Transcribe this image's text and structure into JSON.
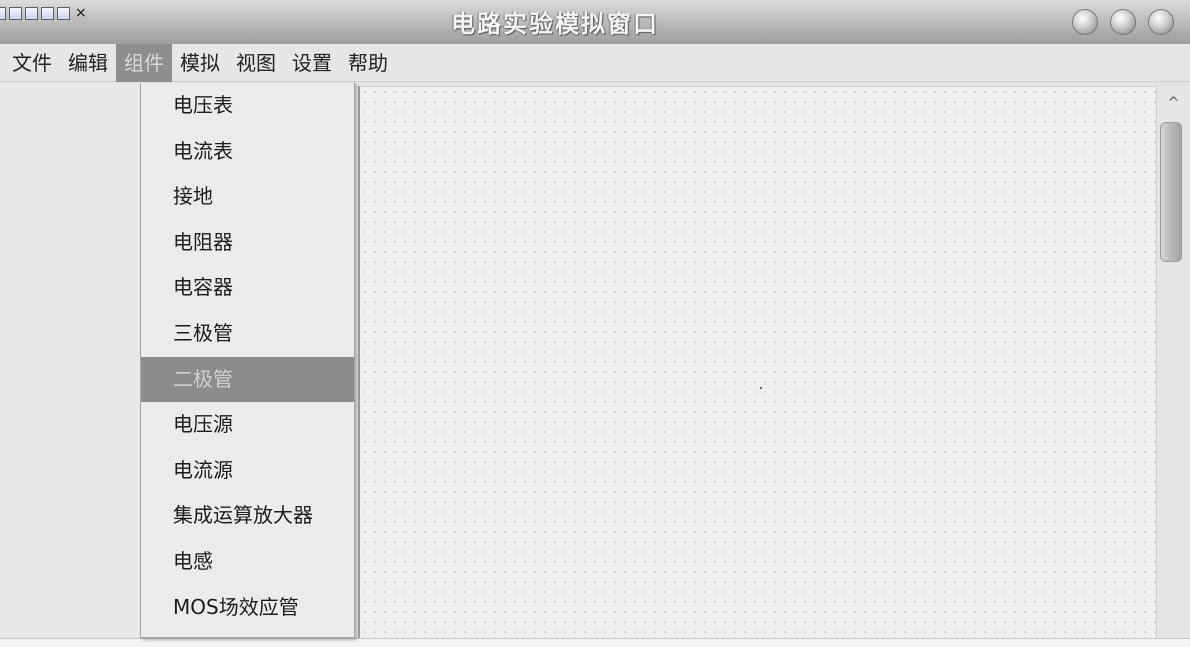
{
  "window": {
    "title": "电路实验模拟窗口"
  },
  "menubar": {
    "items": [
      {
        "label": "文件"
      },
      {
        "label": "编辑"
      },
      {
        "label": "组件"
      },
      {
        "label": "模拟"
      },
      {
        "label": "视图"
      },
      {
        "label": "设置"
      },
      {
        "label": "帮助"
      }
    ],
    "active": "组件"
  },
  "dropdown": {
    "items": [
      {
        "label": "电压表"
      },
      {
        "label": "电流表"
      },
      {
        "label": "接地"
      },
      {
        "label": "电阻器"
      },
      {
        "label": "电容器"
      },
      {
        "label": "三极管"
      },
      {
        "label": "二极管"
      },
      {
        "label": "电压源"
      },
      {
        "label": "电流源"
      },
      {
        "label": "集成运算放大器"
      },
      {
        "label": "电感"
      },
      {
        "label": "MOS场效应管"
      }
    ],
    "selected": "二极管"
  },
  "icons": {
    "toolbar": [
      "doc-icon",
      "print-icon",
      "preview-icon",
      "word-icon",
      "wand-icon"
    ],
    "close": "×",
    "scroll_up": "^"
  },
  "colors": {
    "menu_active_bg": "#8e8e8e",
    "selection_bg": "#8c8c8c"
  }
}
